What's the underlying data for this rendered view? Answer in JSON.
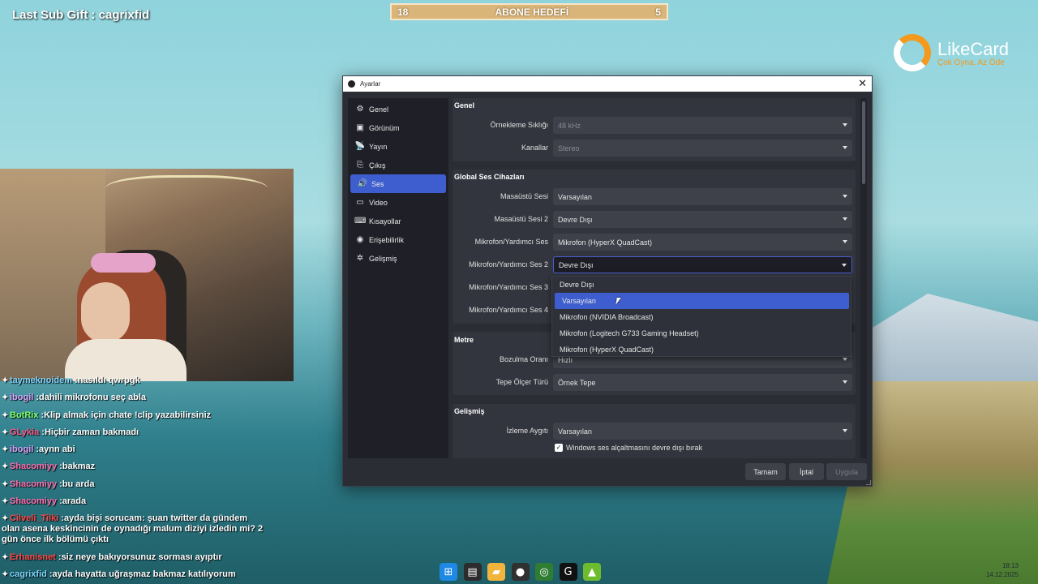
{
  "overlay": {
    "last_sub": "Last Sub Gift : cagrixfid",
    "goal": {
      "left": "18",
      "title": "ABONE HEDEFİ",
      "right": "5"
    },
    "logo": {
      "name": "LikeCard",
      "tagline": "Çok Oyna, Az Öde"
    }
  },
  "chat": [
    {
      "user": "taymeknoidem",
      "user_color": "#7cd7ff",
      "msg": "nasıldı qwrpgk"
    },
    {
      "user": "ibogil",
      "user_color": "#d9a8ff",
      "msg": "dahili mikrofonu seç abla"
    },
    {
      "user": "BotRix",
      "user_color": "#7dff6a",
      "msg": "Klip almak için chate !clip yazabilirsiniz"
    },
    {
      "user": "GLykia",
      "user_color": "#ff5a8a",
      "msg": "Hiçbir zaman bakmadı"
    },
    {
      "user": "ibogil",
      "user_color": "#d9a8ff",
      "msg": "aynn abi"
    },
    {
      "user": "Shacomiyy",
      "user_color": "#ff6fb0",
      "msg": "bakmaz"
    },
    {
      "user": "Shacomiyy",
      "user_color": "#ff6fb0",
      "msg": "bu arda"
    },
    {
      "user": "Shacomiyy",
      "user_color": "#ff6fb0",
      "msg": "arada"
    },
    {
      "user": "Cilveli_Tilki",
      "user_color": "#ff4a4a",
      "msg": "ayda bişi sorucam: şuan twitter da gündem olan asena keskincinin de oynadığı malum diziyi izledin mi? 2 gün önce ilk bölümü çıktı"
    },
    {
      "user": "Erhanisnet",
      "user_color": "#ff4a4a",
      "msg": "siz neye bakıyorsunuz sorması ayıptır"
    },
    {
      "user": "cagrixfid",
      "user_color": "#7cd7ff",
      "msg": "ayda hayatta uğraşmaz bakmaz katılıyorum"
    }
  ],
  "taskbar": {
    "icons": [
      "windows-icon",
      "explorer-icon",
      "folder-icon",
      "obs-icon",
      "chrome-icon",
      "app-g-icon",
      "game-icon"
    ],
    "time": "18:13",
    "date": "14.12.2025"
  },
  "dialog": {
    "title": "Ayarlar",
    "sidebar": [
      {
        "label": "Genel",
        "icon": "gear-icon",
        "glyph": "⚙"
      },
      {
        "label": "Görünüm",
        "icon": "appearance-icon",
        "glyph": "▣"
      },
      {
        "label": "Yayın",
        "icon": "stream-icon",
        "glyph": "📡"
      },
      {
        "label": "Çıkış",
        "icon": "output-icon",
        "glyph": "⎘"
      },
      {
        "label": "Ses",
        "icon": "speaker-icon",
        "glyph": "🔊",
        "active": true
      },
      {
        "label": "Video",
        "icon": "monitor-icon",
        "glyph": "▭"
      },
      {
        "label": "Kısayollar",
        "icon": "keyboard-icon",
        "glyph": "⌨"
      },
      {
        "label": "Erişebilirlik",
        "icon": "accessibility-icon",
        "glyph": "◉"
      },
      {
        "label": "Gelişmiş",
        "icon": "tools-icon",
        "glyph": "✲"
      }
    ],
    "general": {
      "title": "Genel",
      "sample_rate": {
        "label": "Örnekleme Sıklığı",
        "value": "48 kHz"
      },
      "channels": {
        "label": "Kanallar",
        "value": "Stereo"
      }
    },
    "global": {
      "title": "Global Ses Cihazları",
      "rows": [
        {
          "label": "Masaüstü Sesi",
          "value": "Varsayılan"
        },
        {
          "label": "Masaüstü Sesi 2",
          "value": "Devre Dışı"
        },
        {
          "label": "Mikrofon/Yardımcı Ses",
          "value": "Mikrofon (HyperX QuadCast)"
        },
        {
          "label": "Mikrofon/Yardımcı Ses 2",
          "value": "Devre Dışı"
        },
        {
          "label": "Mikrofon/Yardımcı Ses 3",
          "value": ""
        },
        {
          "label": "Mikrofon/Yardımcı Ses 4",
          "value": ""
        }
      ]
    },
    "dropdown": {
      "options": [
        "Devre Dışı",
        "Varsayılan",
        "Mikrofon (NVIDIA Broadcast)",
        "Mikrofon (Logitech G733 Gaming Headset)",
        "Mikrofon (HyperX QuadCast)"
      ],
      "highlighted": "Varsayılan"
    },
    "meters": {
      "title": "Metre",
      "decay": {
        "label": "Bozulma Oranı",
        "value": "Hızlı"
      },
      "peak": {
        "label": "Tepe Ölçer Türü",
        "value": "Örnek Tepe"
      }
    },
    "advanced": {
      "title": "Gelişmiş",
      "monitor": {
        "label": "İzleme Aygıtı",
        "value": "Varsayılan"
      },
      "ducking": "Windows ses alçaltmasını devre dışı bırak"
    },
    "buttons": {
      "ok": "Tamam",
      "cancel": "İptal",
      "apply": "Uygula"
    }
  }
}
